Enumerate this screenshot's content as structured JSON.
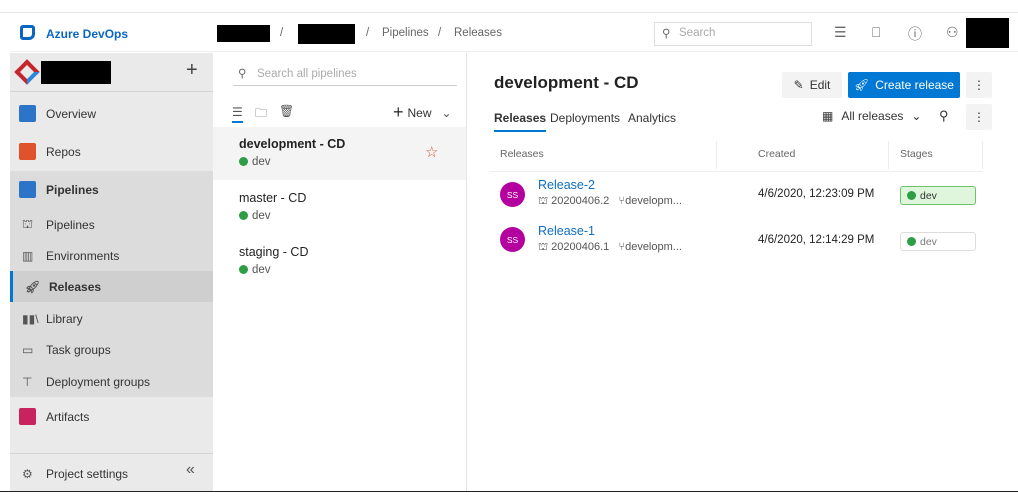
{
  "header": {
    "brand": "Azure DevOps",
    "breadcrumb": [
      "Pipelines",
      "Releases"
    ],
    "search_placeholder": "Search"
  },
  "sidebar": {
    "items": [
      {
        "label": "Overview"
      },
      {
        "label": "Repos"
      },
      {
        "label": "Pipelines"
      },
      {
        "label": "Pipelines"
      },
      {
        "label": "Environments"
      },
      {
        "label": "Releases"
      },
      {
        "label": "Library"
      },
      {
        "label": "Task groups"
      },
      {
        "label": "Deployment groups"
      },
      {
        "label": "Artifacts"
      }
    ],
    "settings": "Project settings"
  },
  "mid": {
    "search_placeholder": "Search all pipelines",
    "new_label": "New",
    "pipelines": [
      {
        "name": "development - CD",
        "stage": "dev"
      },
      {
        "name": "master - CD",
        "stage": "dev"
      },
      {
        "name": "staging - CD",
        "stage": "dev"
      }
    ]
  },
  "main": {
    "title": "development - CD",
    "edit": "Edit",
    "create": "Create release",
    "tabs": [
      "Releases",
      "Deployments",
      "Analytics"
    ],
    "filter_label": "All releases",
    "columns": [
      "Releases",
      "Created",
      "Stages"
    ],
    "releases": [
      {
        "initials": "SS",
        "name": "Release-2",
        "build": "20200406.2",
        "branch": "developm...",
        "created": "4/6/2020, 12:23:09 PM",
        "stage": "dev"
      },
      {
        "initials": "SS",
        "name": "Release-1",
        "build": "20200406.1",
        "branch": "developm...",
        "created": "4/6/2020, 12:14:29 PM",
        "stage": "dev"
      }
    ]
  },
  "colors": {
    "accent": "#0078d4",
    "success": "#2e9e46",
    "avatar": "#b4009e"
  }
}
